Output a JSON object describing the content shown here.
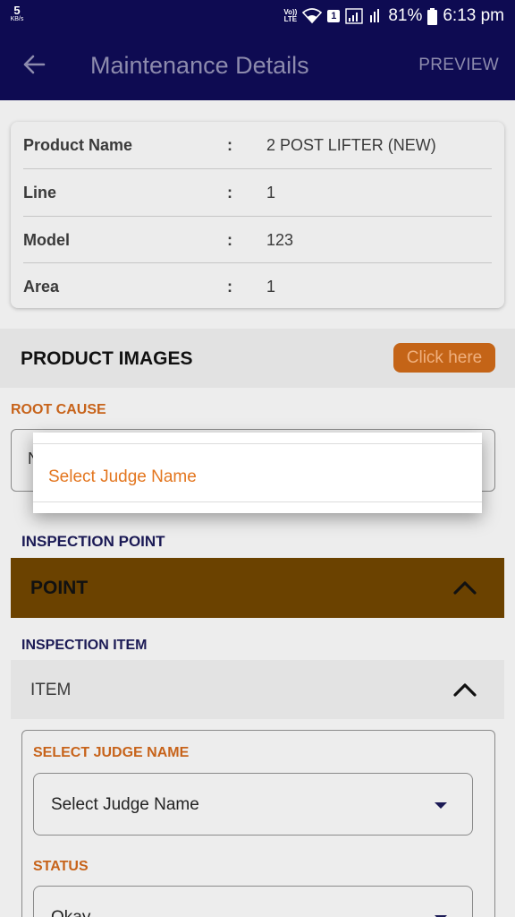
{
  "status_bar": {
    "speed_value": "5",
    "speed_unit": "KB/s",
    "volte": "Vo)) LTE",
    "sim_badge": "1",
    "battery_pct": "81%",
    "time": "6:13 pm"
  },
  "app_bar": {
    "title": "Maintenance Details",
    "preview_label": "PREVIEW"
  },
  "details": [
    {
      "label": "Product Name",
      "sep": ":",
      "value": "2 POST LIFTER (NEW)"
    },
    {
      "label": "Line",
      "sep": ":",
      "value": "1"
    },
    {
      "label": "Model",
      "sep": ":",
      "value": "123"
    },
    {
      "label": "Area",
      "sep": ":",
      "value": "1"
    }
  ],
  "product_images": {
    "title": "PRODUCT IMAGES",
    "button_label": "Click here"
  },
  "root_cause": {
    "label": "ROOT CAUSE",
    "peek_char": "N"
  },
  "inspection_point": {
    "label": "INSPECTION POINT",
    "bar_title": "POINT"
  },
  "inspection_item": {
    "label": "INSPECTION ITEM",
    "bar_title": "ITEM"
  },
  "judge": {
    "label": "SELECT JUDGE NAME",
    "selected": "Select Judge Name"
  },
  "status": {
    "label": "STATUS",
    "selected": "Okay"
  },
  "dialog": {
    "option": "Select Judge Name"
  },
  "colors": {
    "primary": "#0e0b52",
    "accent_orange": "#e3761f",
    "point_bar": "#6b4200"
  }
}
